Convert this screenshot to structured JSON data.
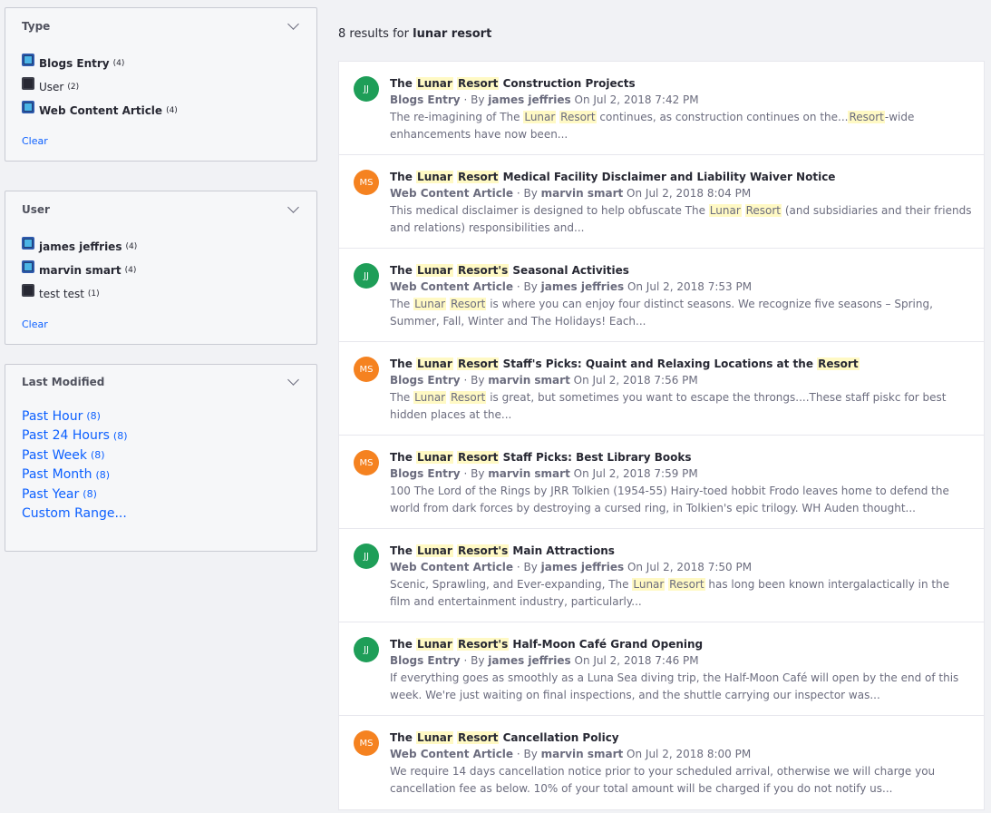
{
  "type_facet": {
    "title": "Type",
    "items": [
      {
        "label": "Blogs Entry",
        "count": "(4)",
        "checked": true
      },
      {
        "label": "User",
        "count": "(2)",
        "checked": false
      },
      {
        "label": "Web Content Article",
        "count": "(4)",
        "checked": true
      }
    ],
    "clear_label": "Clear"
  },
  "user_facet": {
    "title": "User",
    "items": [
      {
        "label": "james jeffries",
        "count": "(4)",
        "checked": true
      },
      {
        "label": "marvin smart",
        "count": "(4)",
        "checked": true
      },
      {
        "label": "test test",
        "count": "(1)",
        "checked": false
      }
    ],
    "clear_label": "Clear"
  },
  "modified_facet": {
    "title": "Last Modified",
    "items": [
      {
        "label": "Past Hour",
        "count": "(8)"
      },
      {
        "label": "Past 24 Hours",
        "count": "(8)"
      },
      {
        "label": "Past Week",
        "count": "(8)"
      },
      {
        "label": "Past Month",
        "count": "(8)"
      },
      {
        "label": "Past Year",
        "count": "(8)"
      },
      {
        "label": "Custom Range...",
        "count": ""
      }
    ]
  },
  "results_header": {
    "prefix": "8 results for",
    "query": "lunar resort"
  },
  "colors": {
    "accent": "#0b5fff",
    "avatar_green": "#1e9e58",
    "avatar_orange": "#f58220",
    "highlight": "#fff9c4"
  },
  "results": [
    {
      "initials": "JJ",
      "avatar_color": "green",
      "title": [
        [
          "The ",
          false
        ],
        [
          "Lunar",
          true
        ],
        [
          " ",
          false
        ],
        [
          "Resort",
          true
        ],
        [
          " Construction Projects",
          false
        ]
      ],
      "type": "Blogs Entry",
      "by": "· By",
      "author": "james jeffries",
      "date": "On Jul 2, 2018 7:42 PM",
      "desc": [
        [
          "The re-imagining of The ",
          false
        ],
        [
          "Lunar",
          true
        ],
        [
          " ",
          false
        ],
        [
          "Resort",
          true
        ],
        [
          " continues, as construction continues on the...",
          false
        ],
        [
          "Resort",
          true
        ],
        [
          "-wide enhancements have now been...",
          false
        ]
      ]
    },
    {
      "initials": "MS",
      "avatar_color": "orange",
      "title": [
        [
          "The ",
          false
        ],
        [
          "Lunar",
          true
        ],
        [
          " ",
          false
        ],
        [
          "Resort",
          true
        ],
        [
          " Medical Facility Disclaimer and Liability Waiver Notice",
          false
        ]
      ],
      "type": "Web Content Article",
      "by": "· By",
      "author": "marvin smart",
      "date": "On Jul 2, 2018 8:04 PM",
      "desc": [
        [
          "This medical disclaimer is designed to help obfuscate The ",
          false
        ],
        [
          "Lunar",
          true
        ],
        [
          " ",
          false
        ],
        [
          "Resort",
          true
        ],
        [
          " (and subsidiaries and their friends and relations) responsibilities and...",
          false
        ]
      ]
    },
    {
      "initials": "JJ",
      "avatar_color": "green",
      "title": [
        [
          "The ",
          false
        ],
        [
          "Lunar",
          true
        ],
        [
          " ",
          false
        ],
        [
          "Resort's",
          true
        ],
        [
          " Seasonal Activities",
          false
        ]
      ],
      "type": "Web Content Article",
      "by": "· By",
      "author": "james jeffries",
      "date": "On Jul 2, 2018 7:53 PM",
      "desc": [
        [
          "The ",
          false
        ],
        [
          "Lunar",
          true
        ],
        [
          " ",
          false
        ],
        [
          "Resort",
          true
        ],
        [
          " is where you can enjoy four distinct seasons. We recognize five seasons – Spring, Summer, Fall, Winter and The Holidays! Each...",
          false
        ]
      ]
    },
    {
      "initials": "MS",
      "avatar_color": "orange",
      "title": [
        [
          "The ",
          false
        ],
        [
          "Lunar",
          true
        ],
        [
          " ",
          false
        ],
        [
          "Resort",
          true
        ],
        [
          " Staff's Picks: Quaint and Relaxing Locations at the ",
          false
        ],
        [
          "Resort",
          true
        ]
      ],
      "type": "Blogs Entry",
      "by": "· By",
      "author": "marvin smart",
      "date": "On Jul 2, 2018 7:56 PM",
      "desc": [
        [
          "The ",
          false
        ],
        [
          "Lunar",
          true
        ],
        [
          " ",
          false
        ],
        [
          "Resort",
          true
        ],
        [
          " is great, but sometimes you want to escape the throngs....These staff piskc for best hidden places at the...",
          false
        ]
      ]
    },
    {
      "initials": "MS",
      "avatar_color": "orange",
      "title": [
        [
          "The ",
          false
        ],
        [
          "Lunar",
          true
        ],
        [
          " ",
          false
        ],
        [
          "Resort",
          true
        ],
        [
          " Staff Picks: Best Library Books",
          false
        ]
      ],
      "type": "Blogs Entry",
      "by": "· By",
      "author": "marvin smart",
      "date": "On Jul 2, 2018 7:59 PM",
      "desc": [
        [
          "100 The Lord of the Rings by JRR Tolkien (1954-55) Hairy-toed hobbit Frodo leaves home to defend the world from dark forces by destroying a cursed ring, in Tolkien's epic trilogy. WH Auden thought...",
          false
        ]
      ]
    },
    {
      "initials": "JJ",
      "avatar_color": "green",
      "title": [
        [
          "The ",
          false
        ],
        [
          "Lunar",
          true
        ],
        [
          " ",
          false
        ],
        [
          "Resort's",
          true
        ],
        [
          " Main Attractions",
          false
        ]
      ],
      "type": "Web Content Article",
      "by": "· By",
      "author": "james jeffries",
      "date": "On Jul 2, 2018 7:50 PM",
      "desc": [
        [
          "Scenic, Sprawling, and Ever-expanding, The ",
          false
        ],
        [
          "Lunar",
          true
        ],
        [
          " ",
          false
        ],
        [
          "Resort",
          true
        ],
        [
          " has long been known intergalactically in the film and entertainment industry, particularly...",
          false
        ]
      ]
    },
    {
      "initials": "JJ",
      "avatar_color": "green",
      "title": [
        [
          "The ",
          false
        ],
        [
          "Lunar",
          true
        ],
        [
          " ",
          false
        ],
        [
          "Resort's",
          true
        ],
        [
          " Half-Moon Café Grand Opening",
          false
        ]
      ],
      "type": "Blogs Entry",
      "by": "· By",
      "author": "james jeffries",
      "date": "On Jul 2, 2018 7:46 PM",
      "desc": [
        [
          "If everything goes as smoothly as a Luna Sea diving trip, the Half-Moon Café will open by the end of this week. We're just waiting on final inspections, and the shuttle carrying our inspector was...",
          false
        ]
      ]
    },
    {
      "initials": "MS",
      "avatar_color": "orange",
      "title": [
        [
          "The ",
          false
        ],
        [
          "Lunar",
          true
        ],
        [
          " ",
          false
        ],
        [
          "Resort",
          true
        ],
        [
          " Cancellation Policy",
          false
        ]
      ],
      "type": "Web Content Article",
      "by": "· By",
      "author": "marvin smart",
      "date": "On Jul 2, 2018 8:00 PM",
      "desc": [
        [
          "We require 14 days cancellation notice prior to your scheduled arrival, otherwise we will charge you cancellation fee as below. 10% of your total amount will be charged if you do not notify us...",
          false
        ]
      ]
    }
  ]
}
